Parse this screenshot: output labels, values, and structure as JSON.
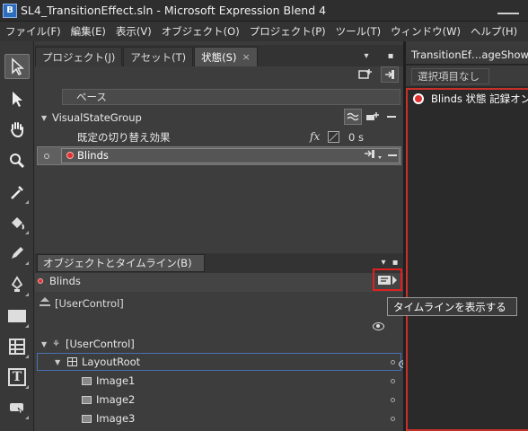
{
  "window": {
    "title": "SL4_TransitionEffect.sln - Microsoft Expression Blend 4"
  },
  "menu": [
    "ファイル(F)",
    "編集(E)",
    "表示(V)",
    "オブジェクト(O)",
    "プロジェクト(P)",
    "ツール(T)",
    "ウィンドウ(W)",
    "ヘルプ(H)"
  ],
  "tabs": {
    "project": "プロジェクト(J)",
    "assets": "アセット(T)",
    "states": "状態(S)",
    "close": "×"
  },
  "states_panel": {
    "base": "ベース",
    "group": "VisualStateGroup",
    "default_transition": "既定の切り替え効果",
    "fx": "fx",
    "duration": "0 s",
    "state_name": "Blinds"
  },
  "objects_panel": {
    "title": "オブジェクトとタイムライン(B)",
    "storyboard": "Blinds",
    "scope": "[UserControl]",
    "tree": [
      {
        "label": "[UserControl]"
      },
      {
        "label": "LayoutRoot"
      },
      {
        "label": "Image1"
      },
      {
        "label": "Image2"
      },
      {
        "label": "Image3"
      }
    ]
  },
  "document": {
    "tab": "TransitionEf…ageShow.",
    "selection": "選択項目なし",
    "recording": "Blinds 状態 記録オン"
  },
  "tooltip": "タイムラインを表示する",
  "colors": {
    "recording_red": "#c8302a",
    "highlight_box": "#e02020",
    "selection_border": "#4a6fb5"
  }
}
